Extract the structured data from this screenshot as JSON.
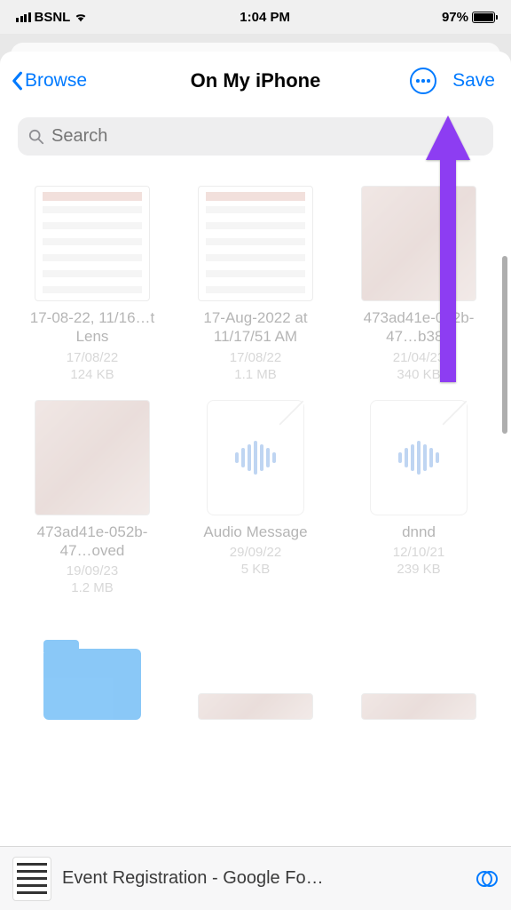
{
  "status": {
    "carrier": "BSNL",
    "time": "1:04 PM",
    "battery_pct": "97%"
  },
  "nav": {
    "back_label": "Browse",
    "title": "On My iPhone",
    "save_label": "Save"
  },
  "search": {
    "placeholder": "Search"
  },
  "files": [
    {
      "name": "17-08-22, 11/16…t Lens",
      "date": "17/08/22",
      "size": "124 KB",
      "kind": "screenshot"
    },
    {
      "name": "17-Aug-2022 at 11/17/51 AM",
      "date": "17/08/22",
      "size": "1.1 MB",
      "kind": "screenshot"
    },
    {
      "name": "473ad41e-052b-47…b38d",
      "date": "21/04/23",
      "size": "340 KB",
      "kind": "photo"
    },
    {
      "name": "473ad41e-052b-47…oved",
      "date": "19/09/23",
      "size": "1.2 MB",
      "kind": "photo"
    },
    {
      "name": "Audio Message",
      "date": "29/09/22",
      "size": "5 KB",
      "kind": "audio"
    },
    {
      "name": "dnnd",
      "date": "12/10/21",
      "size": "239 KB",
      "kind": "audio"
    }
  ],
  "bottom": {
    "title": "Event Registration - Google Fo…"
  },
  "colors": {
    "accent": "#007aff",
    "annotation": "#8a2be2"
  }
}
